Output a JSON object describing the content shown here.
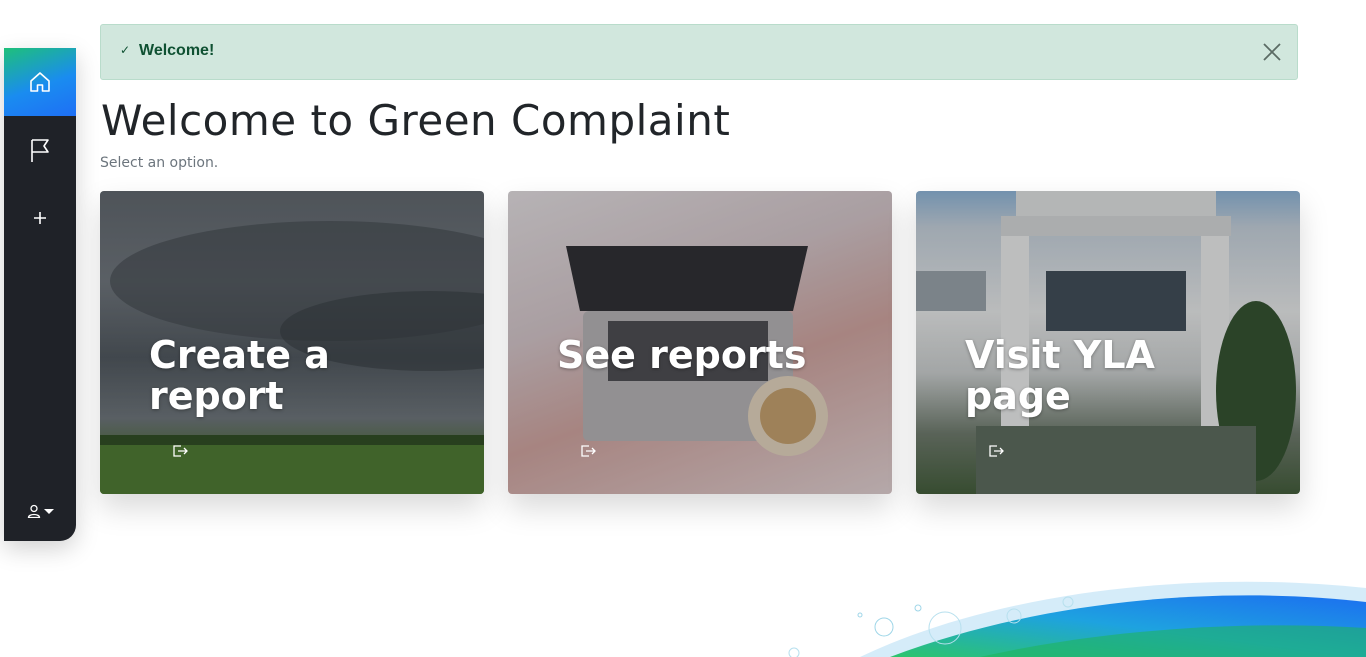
{
  "sidebar": {
    "items": [
      {
        "icon": "home-icon",
        "active": true
      },
      {
        "icon": "flag-icon",
        "active": false
      },
      {
        "icon": "plus-icon",
        "active": false
      }
    ],
    "user_menu_icon": "user-icon"
  },
  "alert": {
    "check": "✓",
    "message": "Welcome!",
    "close_icon": "close-icon",
    "background": "#d1e7dd",
    "text_color": "#0f5132"
  },
  "page": {
    "title": "Welcome to Green Complaint",
    "subtitle": "Select an option."
  },
  "cards": [
    {
      "title": "Create a report",
      "icon": "sign-out-icon",
      "image": "storm clouds over green field"
    },
    {
      "title": "See reports",
      "icon": "sign-out-icon",
      "image": "laptop and coffee on bed"
    },
    {
      "title": "Visit YLA page",
      "icon": "sign-out-icon",
      "image": "group photo in front of building"
    }
  ],
  "colors": {
    "sidebar_bg": "#1f2228",
    "accent_green": "#1ec07a",
    "accent_blue": "#1a8cf0"
  }
}
